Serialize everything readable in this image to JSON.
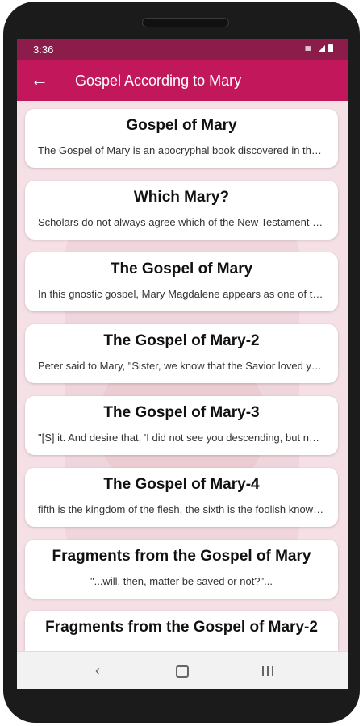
{
  "status_bar": {
    "time": "3:36"
  },
  "app_bar": {
    "title": "Gospel According to Mary"
  },
  "items": [
    {
      "title": "Gospel of Mary",
      "subtitle": "The Gospel of Mary is an apocryphal book discovered in the nineteenth century"
    },
    {
      "title": "Which Mary?",
      "subtitle": "Scholars do not always agree which of the New Testament Marys is the central character"
    },
    {
      "title": "The Gospel of Mary",
      "subtitle": "In this gnostic gospel, Mary Magdalene appears as one of the disciples"
    },
    {
      "title": "The Gospel of Mary-2",
      "subtitle": "Peter said to Mary, \"Sister, we know that the Savior loved you more than the rest of women\""
    },
    {
      "title": "The Gospel of Mary-3",
      "subtitle": "\"[S] it. And desire that, 'I did not see you descending, but now I see you ascending'"
    },
    {
      "title": "The Gospel of Mary-4",
      "subtitle": "fifth is the kingdom of the flesh, the sixth is the foolish knowledge of the flesh"
    },
    {
      "title": "Fragments from the Gospel of Mary",
      "subtitle": "\"...will, then, matter be saved or not?\"..."
    },
    {
      "title": "Fragments from the Gospel of Mary-2",
      "subtitle": ""
    }
  ]
}
